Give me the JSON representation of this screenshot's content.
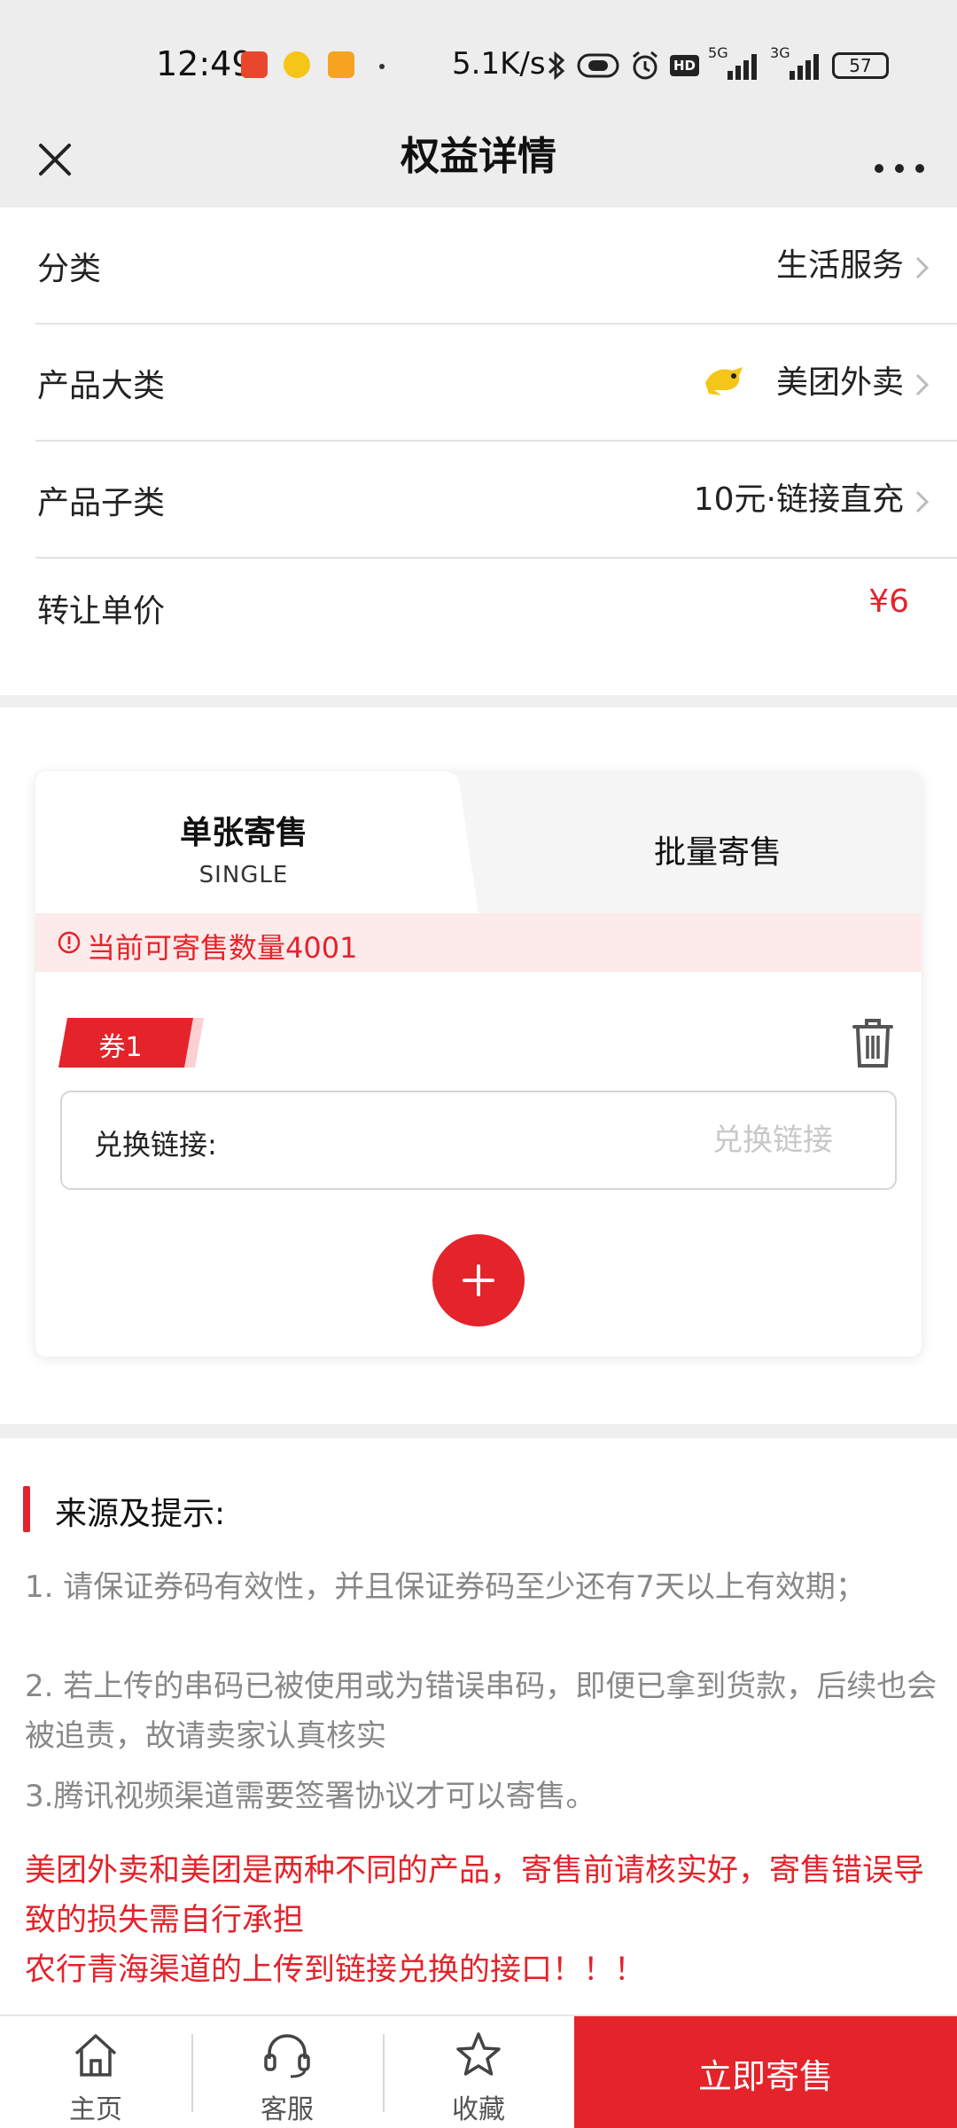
{
  "status_bar": {
    "time": "12:49",
    "net_speed": "5.1K/s",
    "signal_1_label": "5G",
    "signal_2_label": "3G",
    "battery": "57",
    "hd_label": "HD"
  },
  "nav": {
    "title": "权益详情",
    "close_icon": "close-icon",
    "more_icon": "more-icon"
  },
  "info": {
    "rows": [
      {
        "label": "分类",
        "value": "生活服务"
      },
      {
        "label": "产品大类",
        "value": "美团外卖"
      },
      {
        "label": "产品子类",
        "value": "10元·链接直充"
      },
      {
        "label": "转让单价",
        "value": "¥6"
      }
    ]
  },
  "consign": {
    "tab_single_title": "单张寄售",
    "tab_single_sub": "SINGLE",
    "tab_batch": "批量寄售",
    "notice": "当前可寄售数量4001",
    "coupon_tag": "券1",
    "input_label": "兑换链接:",
    "input_placeholder": "兑换链接",
    "input_value": ""
  },
  "tips": {
    "title": "来源及提示:",
    "p1": "1. 请保证券码有效性，并且保证券码至少还有7天以上有效期；",
    "p2": "2. 若上传的串码已被使用或为错误串码，即便已拿到货款，后续也会被追责，故请卖家认真核实",
    "p3": "3.腾讯视频渠道需要签署协议才可以寄售。",
    "r1": "美团外卖和美团是两种不同的产品，寄售前请核实好，寄售错误导致的损失需自行承担",
    "r2": "农行青海渠道的上传到链接兑换的接口！！！"
  },
  "bottom": {
    "home": "主页",
    "service": "客服",
    "favorite": "收藏",
    "consign_now": "立即寄售"
  },
  "colors": {
    "accent": "#e4232b",
    "notice_bg": "#fdeaea"
  }
}
